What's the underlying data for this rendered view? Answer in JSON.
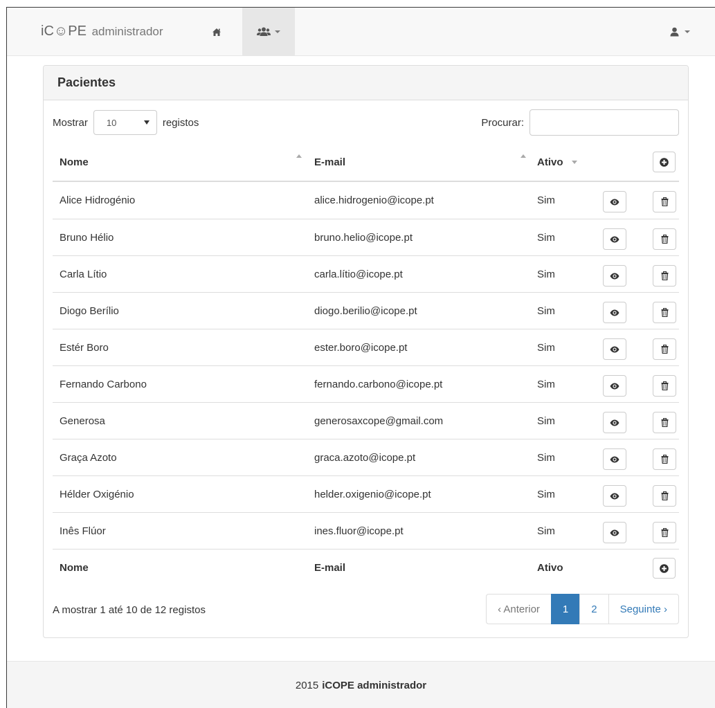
{
  "navbar": {
    "brand_icope": "iC☺PE",
    "brand_admin": "administrador"
  },
  "panel": {
    "title": "Pacientes"
  },
  "controls": {
    "length_prefix": "Mostrar",
    "length_value": "10",
    "length_suffix": "registos",
    "search_label": "Procurar:",
    "search_value": ""
  },
  "table": {
    "headers": {
      "name": "Nome",
      "email": "E-mail",
      "active": "Ativo"
    },
    "rows": [
      {
        "name": "Alice Hidrogénio",
        "email": "alice.hidrogenio@icope.pt",
        "active": "Sim"
      },
      {
        "name": "Bruno Hélio",
        "email": "bruno.helio@icope.pt",
        "active": "Sim"
      },
      {
        "name": "Carla Lítio",
        "email": "carla.lítio@icope.pt",
        "active": "Sim"
      },
      {
        "name": "Diogo Berílio",
        "email": "diogo.berilio@icope.pt",
        "active": "Sim"
      },
      {
        "name": "Estér Boro",
        "email": "ester.boro@icope.pt",
        "active": "Sim"
      },
      {
        "name": "Fernando Carbono",
        "email": "fernando.carbono@icope.pt",
        "active": "Sim"
      },
      {
        "name": "Generosa",
        "email": "generosaxcope@gmail.com",
        "active": "Sim"
      },
      {
        "name": "Graça Azoto",
        "email": "graca.azoto@icope.pt",
        "active": "Sim"
      },
      {
        "name": "Hélder Oxigénio",
        "email": "helder.oxigenio@icope.pt",
        "active": "Sim"
      },
      {
        "name": "Inês Flúor",
        "email": "ines.fluor@icope.pt",
        "active": "Sim"
      }
    ]
  },
  "info": "A mostrar 1 até 10 de 12 registos",
  "pagination": {
    "prev": "‹ Anterior",
    "pages": [
      "1",
      "2"
    ],
    "next": "Seguinte ›"
  },
  "footer": {
    "year": "2015",
    "brand": "iCOPE administrador"
  },
  "colors": {
    "primary": "#337ab7",
    "navbar_bg": "#f8f8f8",
    "panel_heading_bg": "#f5f5f5"
  },
  "icons": [
    "home-icon",
    "users-icon",
    "user-icon",
    "eye-icon",
    "trash-icon",
    "plus-circle-icon"
  ]
}
